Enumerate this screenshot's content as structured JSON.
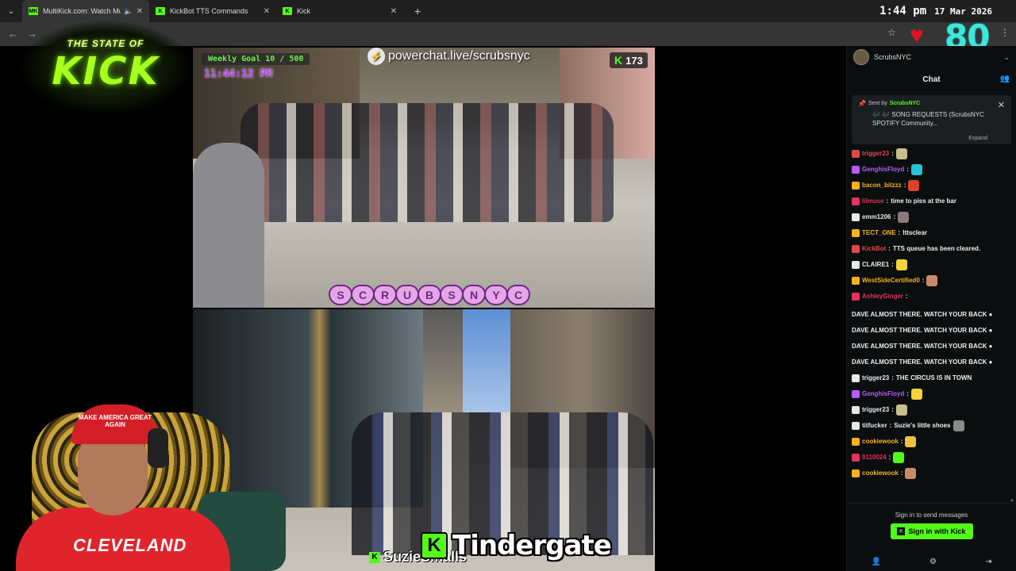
{
  "browser": {
    "tabs": [
      {
        "label": "MultiKick.com: Watch Multi",
        "favicon": "MK",
        "active": true,
        "has_audio": true
      },
      {
        "label": "KickBot TTS Commands",
        "favicon": "K",
        "active": false
      },
      {
        "label": "Kick",
        "favicon": "K",
        "active": false
      }
    ],
    "new_tab": "+",
    "close_glyph": "✕",
    "clock": {
      "time": "1:44 pm",
      "date": "17 Mar 2026"
    }
  },
  "overlay": {
    "logo_top": "THE STATE OF",
    "logo_big": "KICK",
    "heart_count": "80",
    "goal": "Weekly Goal 10 / 500",
    "stream_time": "11:44:12 PM",
    "powerchat": "powerchat.live/scrubsnyc",
    "viewer_count": "173",
    "scrubs_letters": [
      "S",
      "C",
      "R",
      "U",
      "B",
      "S",
      "N",
      "Y",
      "C"
    ],
    "caption_big": "Tindergate",
    "caption_small": "SuzieSmalls",
    "hat_text": "MAKE AMERICA GREAT AGAIN",
    "shirt_text": "CLEVELAND"
  },
  "chat": {
    "channel": "ScrubsNYC",
    "title": "Chat",
    "pinned": {
      "sent_by_label": "Sent by",
      "sender": "ScrubsNYC",
      "message": "🎶 🎶 SONG REQUESTS (ScrubsNYC SPOTIFY Community...",
      "expand": "Expand"
    },
    "messages": [
      {
        "user": "trigger23",
        "color": "#e04a4a",
        "text": "",
        "emote": "#c8c08a"
      },
      {
        "user": "GenghisFloyd",
        "color": "#b65bff",
        "text": "",
        "emote": "#27c3d6"
      },
      {
        "user": "bacon_bitzzz",
        "color": "#f5b21c",
        "text": "",
        "emote": "#d9452a"
      },
      {
        "user": "lilmuse",
        "color": "#e3325c",
        "text": "time to piss at the bar",
        "emote": ""
      },
      {
        "user": "emm1206",
        "color": "#e8e8e8",
        "text": "",
        "emote": "#8a7a7a"
      },
      {
        "user": "TECT_ONE",
        "color": "#f5b21c",
        "text": "lttsclear",
        "emote": ""
      },
      {
        "user": "KickBot",
        "color": "#e04a4a",
        "text": "TTS queue has been cleared.",
        "emote": ""
      },
      {
        "user": "CLAIRE1",
        "color": "#e8e8e8",
        "text": "",
        "emote": "#f3d23b"
      },
      {
        "user": "WestSideCertified0",
        "color": "#f5b21c",
        "text": "",
        "emote": "#c98a6a"
      },
      {
        "user": "AshleyGinger",
        "color": "#e3325c",
        "text": "DAVE ALMOST THERE. WATCH YOUR BACK ● DAVE ALMOST THERE. WATCH YOUR BACK ● DAVE ALMOST THERE. WATCH YOUR BACK ● DAVE ALMOST THERE. WATCH YOUR BACK ●",
        "emote": ""
      },
      {
        "user": "trigger23",
        "color": "#e8e8e8",
        "text": "THE CIRCUS IS IN TOWN",
        "emote": ""
      },
      {
        "user": "GenghisFloyd",
        "color": "#b65bff",
        "text": "",
        "emote": "#f3d23b"
      },
      {
        "user": "trigger23",
        "color": "#e8e8e8",
        "text": "",
        "emote": "#c8c08a"
      },
      {
        "user": "titfucker",
        "color": "#e8e8e8",
        "text": "Suzie's little shoes",
        "emote": "#8a8a8a"
      },
      {
        "user": "cookiewook",
        "color": "#f5b21c",
        "text": "",
        "emote": "#f0c040"
      },
      {
        "user": "9110024",
        "color": "#e3325c",
        "text": "",
        "emote": "#53fc18"
      },
      {
        "user": "cookiewook",
        "color": "#f5b21c",
        "text": "",
        "emote": "#c98a6a"
      }
    ],
    "sign_in_prompt": "Sign in to send messages",
    "sign_in_button": "Sign in with Kick"
  },
  "icons": {
    "back": "back-arrow-icon",
    "forward": "forward-arrow-icon",
    "star": "bookmark-star-icon",
    "heart": "heart-icon",
    "users": "users-icon",
    "add_user": "add-user-icon",
    "settings": "gear-icon",
    "exit": "exit-icon"
  },
  "colors": {
    "kick_green": "#53fc18",
    "chat_bg": "#0b0e0f",
    "teal_counter": "#3ee6d8"
  }
}
